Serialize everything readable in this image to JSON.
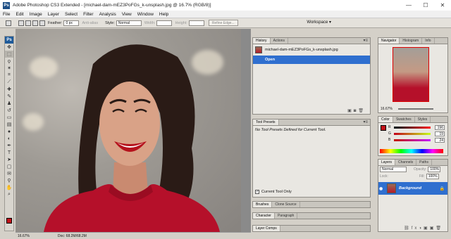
{
  "title_bar": {
    "text": "Adobe Photoshop CS3 Extended - [michael-dam-mEZ3PoFGs_k-unsplash.jpg @ 16.7% (RGB/8)]",
    "app_icon": "PS"
  },
  "window_controls": {
    "minimize": "—",
    "maximize": "☐",
    "close": "✕"
  },
  "menu": [
    "File",
    "Edit",
    "Image",
    "Layer",
    "Select",
    "Filter",
    "Analysis",
    "View",
    "Window",
    "Help"
  ],
  "options_bar": {
    "feather_label": "Feather:",
    "feather_value": "0 px",
    "antialias_label": "Anti-alias",
    "style_label": "Style:",
    "style_value": "Normal",
    "width_label": "Width:",
    "height_label": "Height:",
    "refine_edge": "Refine Edge...",
    "workspace": "Workspace ▾"
  },
  "toolbox": {
    "logo": "Ps"
  },
  "status": {
    "zoom": "16.67%",
    "doc": "Doc: 68.2M/68.2M"
  },
  "history_panel": {
    "tabs": [
      "History",
      "Actions"
    ],
    "snapshot": "michael-dam-mEZ3PoFGs_k-unsplash.jpg",
    "state": "Open"
  },
  "tool_presets_panel": {
    "tabs": [
      "Tool Presets"
    ],
    "message": "No Tool Presets Defined for Current Tool.",
    "checkbox_label": "Current Tool Only"
  },
  "brushes_panel": {
    "tabs": [
      "Brushes",
      "Clone Source"
    ]
  },
  "character_panel": {
    "tabs": [
      "Character",
      "Paragraph"
    ]
  },
  "layer_comps_panel": {
    "tabs": [
      "Layer Comps"
    ]
  },
  "navigator_panel": {
    "tabs": [
      "Navigator",
      "Histogram",
      "Info"
    ],
    "zoom": "16.67%"
  },
  "color_panel": {
    "tabs": [
      "Color",
      "Swatches",
      "Styles"
    ],
    "R": "196",
    "G": "19",
    "B": "24",
    "foreground": "#c41318"
  },
  "layers_panel": {
    "tabs": [
      "Layers",
      "Channels",
      "Paths"
    ],
    "blend_mode": "Normal",
    "opacity_label": "Opacity:",
    "opacity": "100%",
    "lock_label": "Lock:",
    "fill_label": "Fill:",
    "fill": "100%",
    "layer_name": "Background"
  }
}
